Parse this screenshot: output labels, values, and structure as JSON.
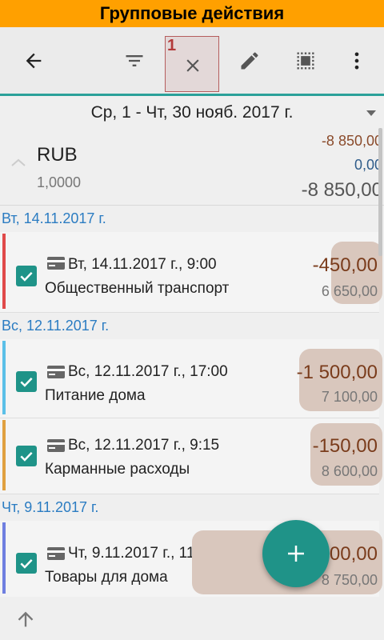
{
  "banner": {
    "title": "Групповые действия"
  },
  "toolbar": {
    "selected_count": "1",
    "icons": [
      "back-arrow-icon",
      "filter-icon",
      "close-icon",
      "edit-icon",
      "select-all-icon",
      "more-vert-icon"
    ]
  },
  "period": {
    "label": "Ср, 1 - Чт, 30 нояб. 2017 г."
  },
  "currency": {
    "code": "RUB",
    "rate": "1,0000",
    "expense": "-8 850,00",
    "income": "0,00",
    "total": "-8 850,00"
  },
  "groups": [
    {
      "date": "Вт, 14.11.2017 г.",
      "transactions": [
        {
          "datetime": "Вт, 14.11.2017 г., 9:00",
          "category": "Общественный транспорт",
          "amount": "-450,00",
          "balance": "6 650,00",
          "color": "#e04a4a",
          "checked": true
        }
      ]
    },
    {
      "date": "Вс, 12.11.2017 г.",
      "transactions": [
        {
          "datetime": "Вс, 12.11.2017 г., 17:00",
          "category": "Питание дома",
          "amount": "-1 500,00",
          "balance": "7 100,00",
          "color": "#5bc0e8",
          "checked": true
        },
        {
          "datetime": "Вс, 12.11.2017 г., 9:15",
          "category": "Карманные расходы",
          "amount": "-150,00",
          "balance": "8 600,00",
          "color": "#e0a040",
          "checked": true
        }
      ]
    },
    {
      "date": "Чт, 9.11.2017 г.",
      "transactions": [
        {
          "datetime": "Чт, 9.11.2017 г., 11:00",
          "category": "Товары для дома",
          "amount": "-100,00",
          "balance": "8 750,00",
          "color": "#6f7fe0",
          "checked": true
        }
      ]
    }
  ],
  "colors": {
    "accent": "#1f9388",
    "banner": "#ffa000",
    "header_date": "#2b7cc2",
    "amount": "#7a3c1c"
  }
}
